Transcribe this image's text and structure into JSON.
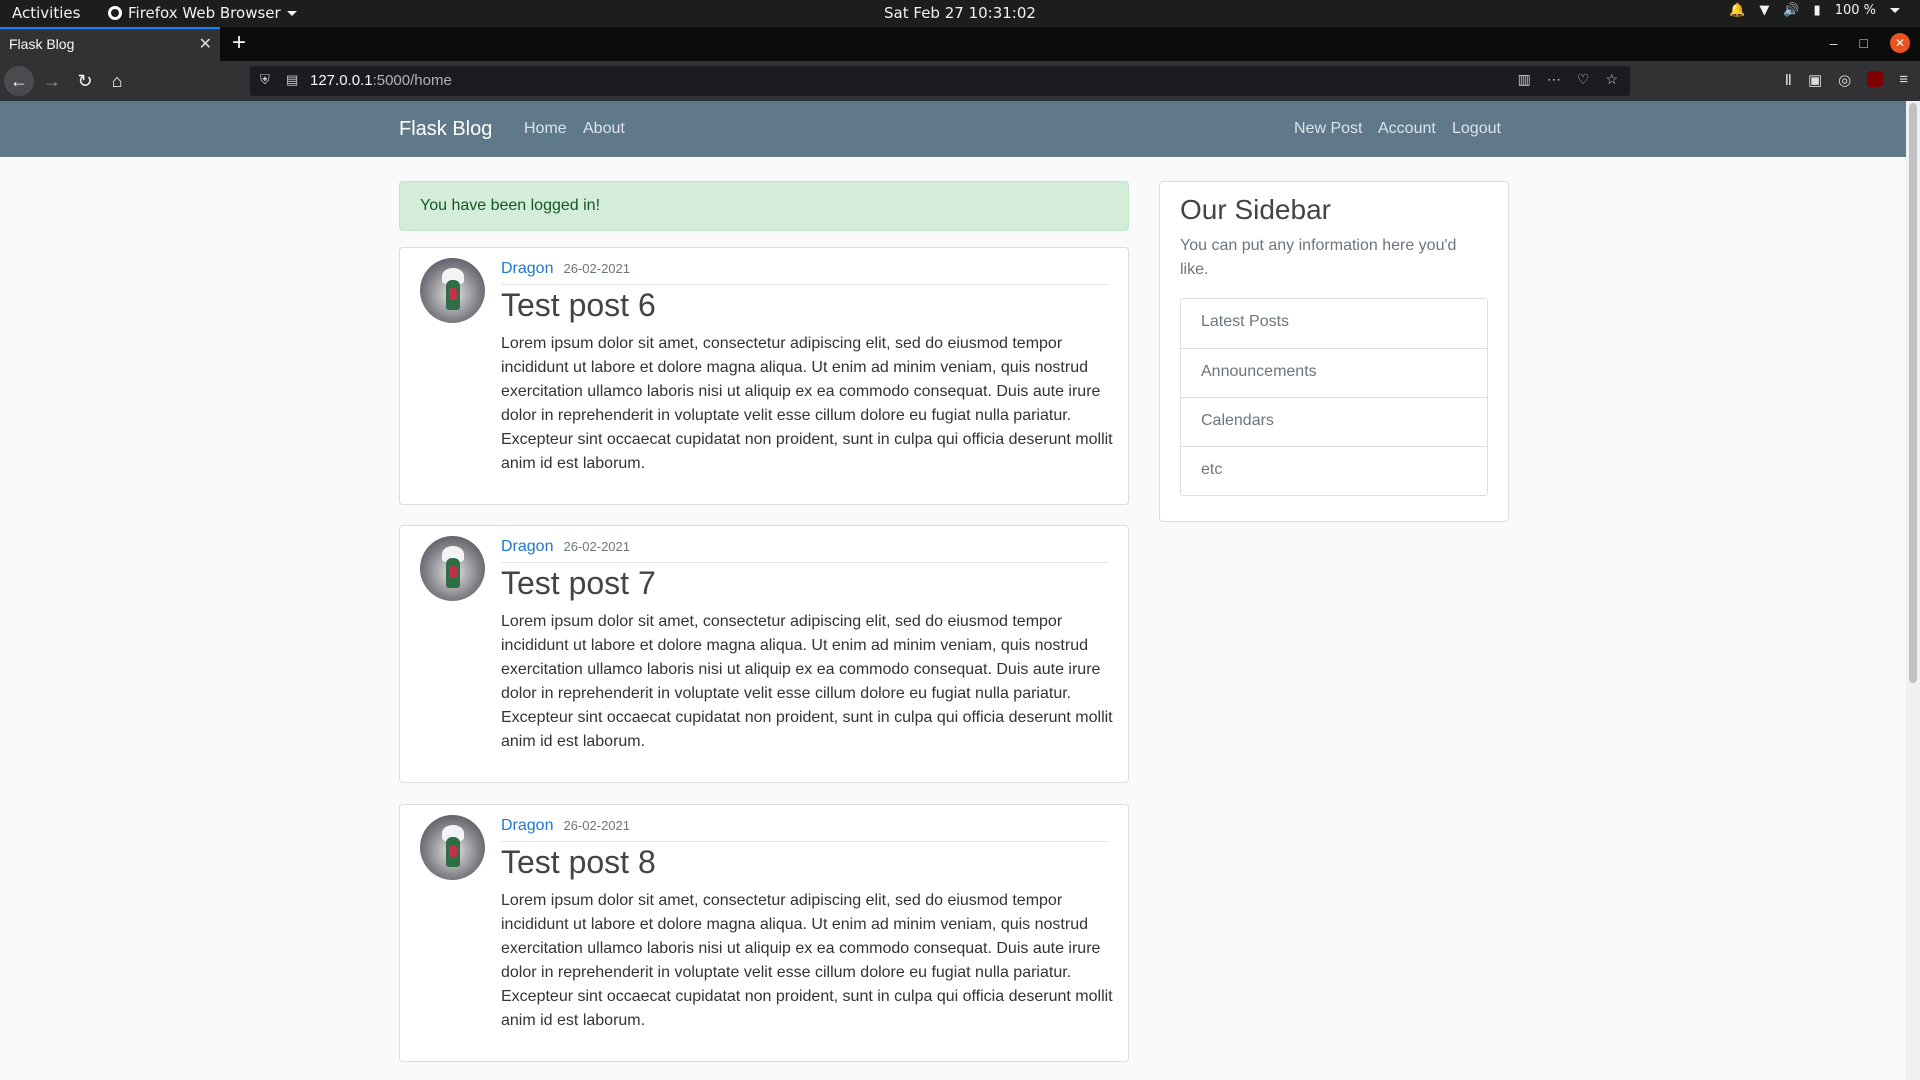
{
  "os_bar": {
    "activities": "Activities",
    "app_name": "Firefox Web Browser",
    "clock": "Sat Feb 27  10:31:02",
    "battery": "100 %"
  },
  "browser": {
    "tab_title": "Flask Blog",
    "url_host": "127.0.0.1",
    "url_path": ":5000/home"
  },
  "site": {
    "brand": "Flask Blog",
    "nav_left": [
      "Home",
      "About"
    ],
    "nav_right": [
      "New Post",
      "Account",
      "Logout"
    ],
    "nav_color": "#5f788a"
  },
  "alert": {
    "message": "You have been logged in!"
  },
  "posts": [
    {
      "author": "Dragon",
      "date": "26-02-2021",
      "title": "Test post 6",
      "content": "Lorem ipsum dolor sit amet, consectetur adipiscing elit, sed do eiusmod tempor incididunt ut labore et dolore magna aliqua. Ut enim ad minim veniam, quis nostrud exercitation ullamco laboris nisi ut aliquip ex ea commodo consequat. Duis aute irure dolor in reprehenderit in voluptate velit esse cillum dolore eu fugiat nulla pariatur. Excepteur sint occaecat cupidatat non proident, sunt in culpa qui officia deserunt mollit anim id est laborum."
    },
    {
      "author": "Dragon",
      "date": "26-02-2021",
      "title": "Test post 7",
      "content": "Lorem ipsum dolor sit amet, consectetur adipiscing elit, sed do eiusmod tempor incididunt ut labore et dolore magna aliqua. Ut enim ad minim veniam, quis nostrud exercitation ullamco laboris nisi ut aliquip ex ea commodo consequat. Duis aute irure dolor in reprehenderit in voluptate velit esse cillum dolore eu fugiat nulla pariatur. Excepteur sint occaecat cupidatat non proident, sunt in culpa qui officia deserunt mollit anim id est laborum."
    },
    {
      "author": "Dragon",
      "date": "26-02-2021",
      "title": "Test post 8",
      "content": "Lorem ipsum dolor sit amet, consectetur adipiscing elit, sed do eiusmod tempor incididunt ut labore et dolore magna aliqua. Ut enim ad minim veniam, quis nostrud exercitation ullamco laboris nisi ut aliquip ex ea commodo consequat. Duis aute irure dolor in reprehenderit in voluptate velit esse cillum dolore eu fugiat nulla pariatur. Excepteur sint occaecat cupidatat non proident, sunt in culpa qui officia deserunt mollit anim id est laborum."
    }
  ],
  "sidebar": {
    "title": "Our Sidebar",
    "text": "You can put any information here you'd like.",
    "items": [
      "Latest Posts",
      "Announcements",
      "Calendars",
      "etc"
    ]
  }
}
